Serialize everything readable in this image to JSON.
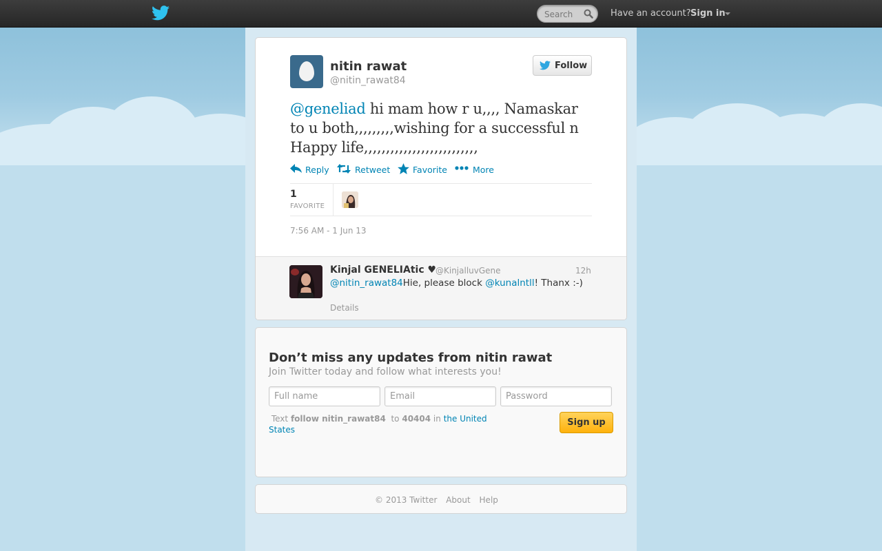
{
  "topbar": {
    "logo_icon": "twitter-bird-icon",
    "search_placeholder": "Search",
    "search_icon": "magnifier-icon",
    "have_account": "Have an account?",
    "sign_in": "Sign in"
  },
  "tweet": {
    "author_name": "nitin rawat",
    "author_handle": "@nitin_rawat84",
    "follow_label": "Follow",
    "text_mention": "@geneliad",
    "text_body": " hi mam how r u,,,, Namaskar to u both,,,,,,,,,wishing for a successful n Happy life,,,,,,,,,,,,,,,,,,,,,,,,,,",
    "actions": {
      "reply": "Reply",
      "retweet": "Retweet",
      "favorite": "Favorite",
      "more": "More"
    },
    "favorites_count": "1",
    "favorites_label": "FAVORITE",
    "timestamp": "7:56 AM - 1 Jun 13"
  },
  "reply": {
    "name": "Kinjal GENELIAtic ♥",
    "handle": "@KinjalluvGene",
    "time": "12h",
    "mention1": "@nitin_rawat84",
    "text1": "Hie, please block ",
    "mention2": "@kunalntll",
    "text2": "! Thanx :-)",
    "details": "Details"
  },
  "signup": {
    "title": "Don’t miss any updates from nitin rawat",
    "subtitle": "Join Twitter today and follow what interests you!",
    "fullname_placeholder": "Full name",
    "email_placeholder": "Email",
    "password_placeholder": "Password",
    "sms_text": "Text",
    "sms_command": "follow nitin_rawat84",
    "sms_to": "to",
    "sms_number": "40404",
    "sms_in": "in",
    "sms_country": "the United States",
    "button": "Sign up"
  },
  "footer": {
    "copyright": "© 2013 Twitter",
    "about": "About",
    "help": "Help"
  },
  "colors": {
    "link": "#0084b4",
    "topbar": "#2f2f2f",
    "sky": "#c0deed",
    "signup_button": "#ffc124"
  }
}
